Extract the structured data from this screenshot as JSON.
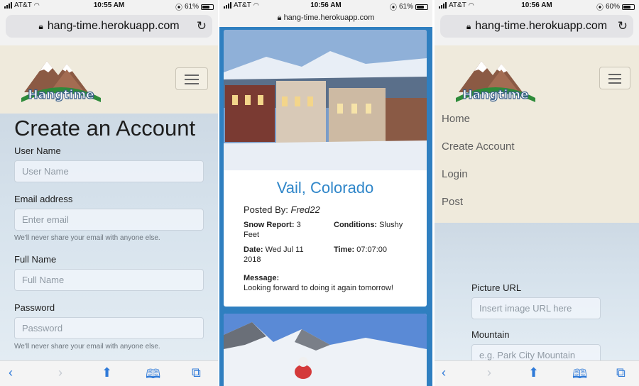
{
  "screens": [
    {
      "status": {
        "carrier": "AT&T",
        "time": "10:55 AM",
        "battery": "61%"
      },
      "url": "hang-time.herokuapp.com",
      "brand": "Hangtime",
      "page_title": "Create an Account",
      "fields": [
        {
          "label": "User Name",
          "placeholder": "User Name",
          "help": ""
        },
        {
          "label": "Email address",
          "placeholder": "Enter email",
          "help": "We'll never share your email with anyone else."
        },
        {
          "label": "Full Name",
          "placeholder": "Full Name",
          "help": ""
        },
        {
          "label": "Password",
          "placeholder": "Password",
          "help": "We'll never share your email with anyone else."
        }
      ]
    },
    {
      "status": {
        "carrier": "AT&T",
        "time": "10:56 AM",
        "battery": "61%"
      },
      "url": "hang-time.herokuapp.com",
      "card": {
        "title": "Vail, Colorado",
        "posted_label": "Posted By:",
        "posted_by": "Fred22",
        "snow_label": "Snow Report:",
        "snow_value": "3",
        "snow_unit": "Feet",
        "conditions_label": "Conditions:",
        "conditions_value": "Slushy",
        "date_label": "Date:",
        "date_value": "Wed Jul 11",
        "date_year": "2018",
        "time_label": "Time:",
        "time_value": "07:07:00",
        "message_label": "Message:",
        "message": "Looking forward to doing it again tomorrow!"
      }
    },
    {
      "status": {
        "carrier": "AT&T",
        "time": "10:56 AM",
        "battery": "60%"
      },
      "url": "hang-time.herokuapp.com",
      "brand": "Hangtime",
      "nav": [
        "Home",
        "Create Account",
        "Login",
        "Post"
      ],
      "fields": [
        {
          "label": "Picture URL",
          "placeholder": "Insert image URL here"
        },
        {
          "label": "Mountain",
          "placeholder": "e.g. Park City Mountain"
        }
      ]
    }
  ],
  "icons": {
    "lock": "lock-icon",
    "reload": "reload-icon",
    "back": "chevron-left-icon",
    "forward": "chevron-right-icon",
    "share": "share-icon",
    "bookmarks": "book-icon",
    "tabs": "tabs-icon"
  },
  "colors": {
    "accent": "#2f86c9",
    "header": "#efeadc",
    "safari_blue": "#2f7ad8"
  }
}
